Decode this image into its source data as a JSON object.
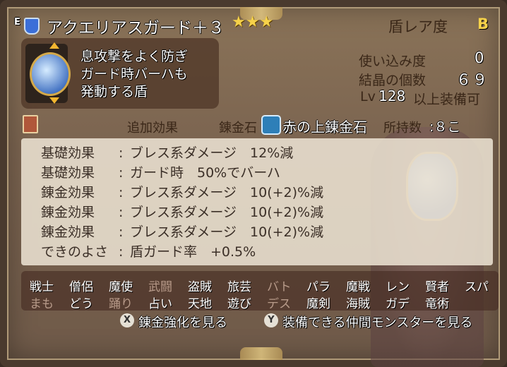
{
  "item": {
    "equip_mark": "E",
    "name": "アクエリアスガード＋３",
    "stars": "★★★",
    "rarity_label": "盾レア度",
    "rarity_value": "B",
    "description_lines": [
      "息攻撃をよく防ぎ",
      "ガード時バーハも",
      "発動する盾"
    ],
    "usage_label": "使い込み度",
    "usage_value": "0",
    "crystal_label": "結晶の個数",
    "crystal_value": "６９",
    "level_prefix": "Lv",
    "level_value": "128",
    "level_suffix": "以上装備可"
  },
  "alchemy": {
    "extra_label": "追加効果",
    "stone_label": "錬金石",
    "stone_name": "赤の上錬金石",
    "owned_label": "所持数",
    "owned_value": ":８こ"
  },
  "effects": [
    {
      "label": "基礎効果",
      "value": "ブレス系ダメージ　12%減"
    },
    {
      "label": "基礎効果",
      "value": "ガード時　50%でバーハ"
    },
    {
      "label": "錬金効果",
      "value": "ブレス系ダメージ　10(+2)%減"
    },
    {
      "label": "錬金効果",
      "value": "ブレス系ダメージ　10(+2)%減"
    },
    {
      "label": "錬金効果",
      "value": "ブレス系ダメージ　10(+2)%減"
    },
    {
      "label": "できのよさ",
      "value": "盾ガード率　+0.5%"
    }
  ],
  "effect_colon": ":",
  "jobs_row1": [
    {
      "name": "戦士",
      "enabled": true
    },
    {
      "name": "僧侶",
      "enabled": true
    },
    {
      "name": "魔使",
      "enabled": true
    },
    {
      "name": "武闘",
      "enabled": false
    },
    {
      "name": "盗賊",
      "enabled": true
    },
    {
      "name": "旅芸",
      "enabled": true
    },
    {
      "name": "バト",
      "enabled": false
    },
    {
      "name": "パラ",
      "enabled": true
    },
    {
      "name": "魔戦",
      "enabled": true
    },
    {
      "name": "レン",
      "enabled": true
    },
    {
      "name": "賢者",
      "enabled": true
    },
    {
      "name": "スパ",
      "enabled": true
    }
  ],
  "jobs_row2": [
    {
      "name": "まも",
      "enabled": false
    },
    {
      "name": "どう",
      "enabled": true
    },
    {
      "name": "踊り",
      "enabled": false
    },
    {
      "name": "占い",
      "enabled": true
    },
    {
      "name": "天地",
      "enabled": true
    },
    {
      "name": "遊び",
      "enabled": true
    },
    {
      "name": "デス",
      "enabled": false
    },
    {
      "name": "魔剣",
      "enabled": true
    },
    {
      "name": "海賊",
      "enabled": true
    },
    {
      "name": "ガデ",
      "enabled": true
    },
    {
      "name": "竜術",
      "enabled": true
    }
  ],
  "buttons": {
    "x_key": "X",
    "x_label": "錬金強化を見る",
    "y_key": "Y",
    "y_label": "装備できる仲間モンスターを見る"
  }
}
